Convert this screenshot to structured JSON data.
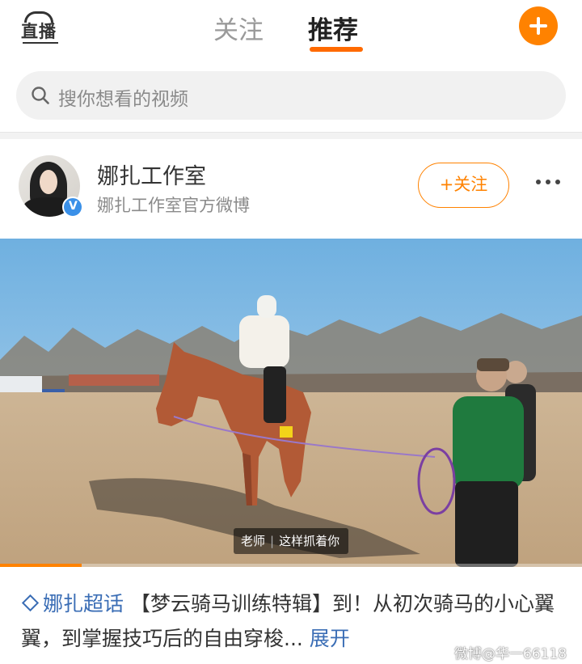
{
  "header": {
    "live_label": "直播",
    "tabs": [
      {
        "label": "关注",
        "active": false
      },
      {
        "label": "推荐",
        "active": true
      }
    ],
    "accent": "#ff8200"
  },
  "search": {
    "placeholder": "搜你想看的视频"
  },
  "post": {
    "author": "娜扎工作室",
    "author_desc": "娜扎工作室官方微博",
    "follow_label": "+关注",
    "video": {
      "caption_speaker": "老师",
      "caption_text": "这样抓着你",
      "progress": 0.14
    },
    "topic": "娜扎超话",
    "text": "【梦云骑马训练特辑】到！从初次骑马的小心翼翼，到掌握技巧后的自由穿梭...",
    "expand_label": "展开"
  },
  "watermark": "微博@华一66118"
}
